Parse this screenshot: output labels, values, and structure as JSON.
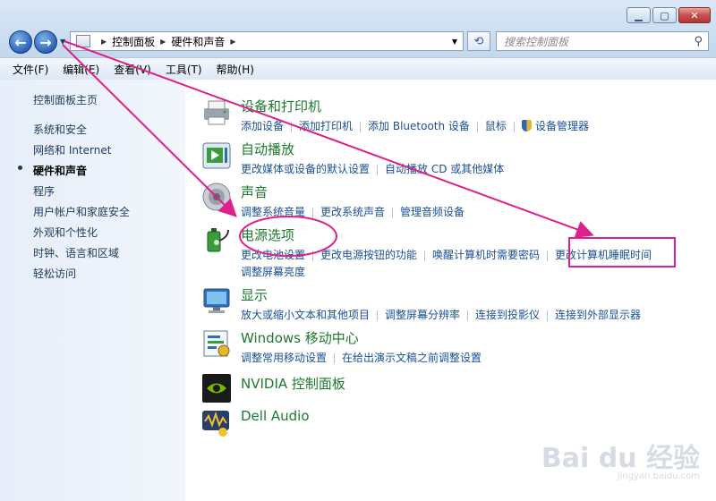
{
  "window": {
    "caption_buttons": {
      "minimize": "▁",
      "maximize": "▢",
      "close": "✕"
    }
  },
  "nav": {
    "back_icon": "←",
    "forward_icon": "→",
    "breadcrumb": [
      "控制面板",
      "硬件和声音"
    ],
    "search_placeholder": "搜索控制面板"
  },
  "menu": [
    "文件(F)",
    "编辑(E)",
    "查看(V)",
    "工具(T)",
    "帮助(H)"
  ],
  "sidebar": {
    "items": [
      "控制面板主页",
      "系统和安全",
      "网络和 Internet",
      "硬件和声音",
      "程序",
      "用户帐户和家庭安全",
      "外观和个性化",
      "时钟、语言和区域",
      "轻松访问"
    ],
    "active_index": 3
  },
  "categories": [
    {
      "title": "设备和打印机",
      "icon": "printer-icon",
      "lines": [
        [
          "添加设备",
          "添加打印机",
          "添加 Bluetooth 设备",
          "鼠标",
          "设备管理器"
        ]
      ]
    },
    {
      "title": "自动播放",
      "icon": "autoplay-icon",
      "lines": [
        [
          "更改媒体或设备的默认设置",
          "自动播放 CD 或其他媒体"
        ]
      ]
    },
    {
      "title": "声音",
      "icon": "speaker-icon",
      "lines": [
        [
          "调整系统音量",
          "更改系统声音",
          "管理音频设备"
        ]
      ]
    },
    {
      "title": "电源选项",
      "icon": "power-icon",
      "lines": [
        [
          "更改电池设置",
          "更改电源按钮的功能",
          "唤醒计算机时需要密码",
          "更改计算机睡眠时间"
        ],
        [
          "调整屏幕亮度"
        ]
      ]
    },
    {
      "title": "显示",
      "icon": "monitor-icon",
      "lines": [
        [
          "放大或缩小文本和其他项目",
          "调整屏幕分辨率",
          "连接到投影仪",
          "连接到外部显示器"
        ]
      ]
    },
    {
      "title": "Windows 移动中心",
      "icon": "mobility-icon",
      "lines": [
        [
          "调整常用移动设置",
          "在给出演示文稿之前调整设置"
        ]
      ]
    },
    {
      "title": "NVIDIA 控制面板",
      "icon": "nvidia-icon",
      "lines": []
    },
    {
      "title": "Dell Audio",
      "icon": "dell-audio-icon",
      "lines": []
    }
  ],
  "watermark": {
    "brand": "Bai du 经验",
    "url": "jingyan.baidu.com"
  },
  "annotation_color": "#e0208a"
}
